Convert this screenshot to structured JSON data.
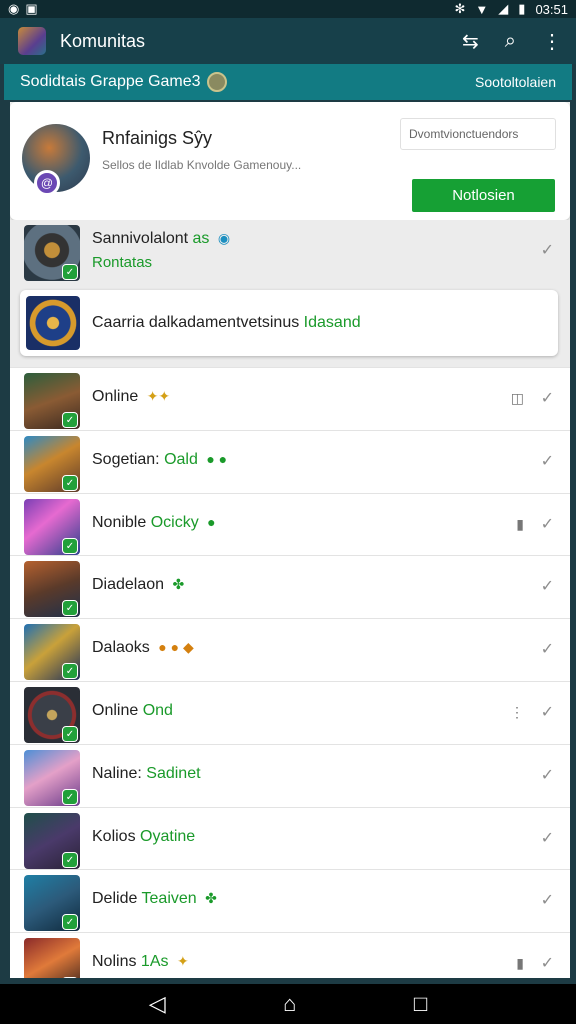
{
  "status_bar": {
    "left_icons": [
      "record-icon",
      "notification-icon"
    ],
    "right_icons": [
      "bluetooth-icon",
      "wifi-icon",
      "signal-icon",
      "battery-icon"
    ],
    "time": "03:51"
  },
  "app_bar": {
    "title": "Komunitas",
    "actions": [
      "switch-icon",
      "search-icon",
      "more-icon"
    ]
  },
  "sub_bar": {
    "title": "Sodidtais Grappe Game3",
    "right_text": "Sootoltolaien"
  },
  "profile_card": {
    "name": "Rnfainigs Sŷy",
    "description": "Sellos de Ildlab Knvolde Gamenouy...",
    "field_placeholder": "Dvomtvionctuendors",
    "button_label": "Notlosien",
    "avatar_badge": "@"
  },
  "list": {
    "rows": [
      {
        "name": "Sannivolalont",
        "status": "as",
        "subtitle": "Rontatas",
        "check": "✓"
      },
      {
        "name": "Caarria dalkadamentvetsinus",
        "status": "Idasand"
      },
      {
        "name": "Online",
        "glyphs": "✦✦",
        "extra": "◫",
        "check": "✓"
      },
      {
        "name": "Sogetian:",
        "status": "Oald",
        "glyphs": "● ●",
        "check": "✓"
      },
      {
        "name": "Nonible",
        "status": "Ocicky",
        "glyphs": "●",
        "extra": "▮",
        "check": "✓"
      },
      {
        "name": "Diadelaon",
        "glyphs": "✤",
        "check": "✓"
      },
      {
        "name": "Dalaoks",
        "glyphs": "● ● ◆",
        "check": "✓"
      },
      {
        "name": "Online",
        "status": "Ond",
        "extra": "⋮",
        "check": "✓"
      },
      {
        "name": "Naline:",
        "status": "Sadinet",
        "check": "✓"
      },
      {
        "name": "Kolios",
        "status": "Oyatine",
        "check": "✓"
      },
      {
        "name": "Delide",
        "status": "Teaiven",
        "glyphs": "✤",
        "check": "✓"
      },
      {
        "name": "Nolins",
        "status": "1As",
        "glyphs": "✦",
        "extra": "▮",
        "check": "✓"
      }
    ]
  },
  "nav_bar": {
    "buttons": [
      "back-icon",
      "home-icon",
      "recents-icon"
    ]
  }
}
